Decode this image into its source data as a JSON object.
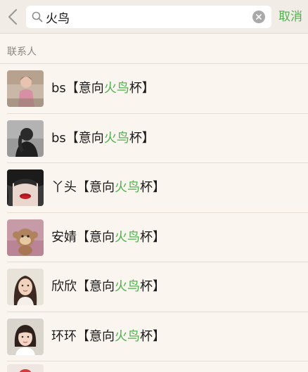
{
  "search": {
    "query": "火鸟",
    "cancel_label": "取消"
  },
  "section": {
    "title": "联系人"
  },
  "contacts": [
    {
      "prefix": "bs【意向",
      "highlight": "火鸟",
      "suffix": "杯】",
      "avatar": "child-photo"
    },
    {
      "prefix": "bs【意向",
      "highlight": "火鸟",
      "suffix": "杯】",
      "avatar": "silhouette-photo"
    },
    {
      "prefix": "丫头【意向",
      "highlight": "火鸟",
      "suffix": "杯】",
      "avatar": "lips-photo"
    },
    {
      "prefix": "安婧【意向",
      "highlight": "火鸟",
      "suffix": "杯】",
      "avatar": "monkey-photo"
    },
    {
      "prefix": "欣欣【意向",
      "highlight": "火鸟",
      "suffix": "杯】",
      "avatar": "woman-photo"
    },
    {
      "prefix": "环环【意向",
      "highlight": "火鸟",
      "suffix": "杯】",
      "avatar": "girl-photo"
    }
  ],
  "colors": {
    "accent": "#4fb24e",
    "background": "#fbf5f0",
    "topbar": "#f2ece6"
  }
}
